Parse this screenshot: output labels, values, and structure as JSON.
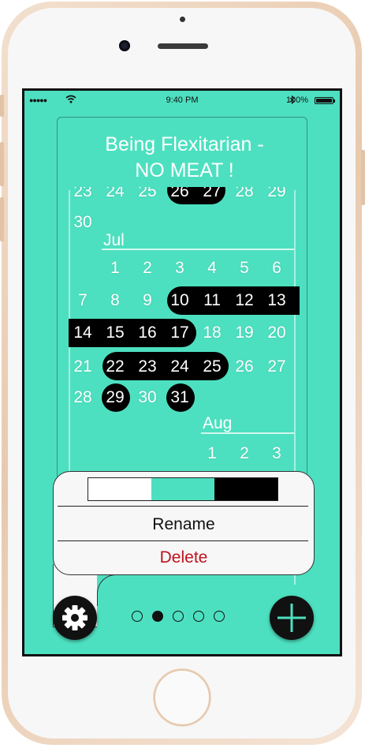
{
  "status_bar": {
    "time": "9:40 PM",
    "battery": "100%",
    "signal_icon": "signal-dots-icon",
    "wifi_icon": "wifi-icon",
    "bluetooth_icon": "bluetooth-icon"
  },
  "habit": {
    "title_line1": "Being Flexitarian -",
    "title_line2": "NO MEAT !"
  },
  "calendar": {
    "partial_june_row": [
      "23",
      "24",
      "25",
      "26",
      "27",
      "28",
      "29"
    ],
    "june_last": "30",
    "months": [
      "Jul",
      "Aug"
    ],
    "july_rows": [
      [
        "1",
        "2",
        "3",
        "4",
        "5",
        "6"
      ],
      [
        "7",
        "8",
        "9",
        "10",
        "11",
        "12",
        "13"
      ],
      [
        "14",
        "15",
        "16",
        "17",
        "18",
        "19",
        "20"
      ],
      [
        "21",
        "22",
        "23",
        "24",
        "25",
        "26",
        "27"
      ],
      [
        "28",
        "29",
        "30",
        "31"
      ]
    ],
    "aug_row": [
      "1",
      "2",
      "3"
    ]
  },
  "popup": {
    "swatch_colors": [
      "#ffffff",
      "#4de0c0",
      "#000000"
    ],
    "rename_label": "Rename",
    "delete_label": "Delete"
  },
  "pager": {
    "count": 5,
    "active_index": 1
  },
  "colors": {
    "accent": "#4de0c0",
    "delete": "#c0111e"
  }
}
